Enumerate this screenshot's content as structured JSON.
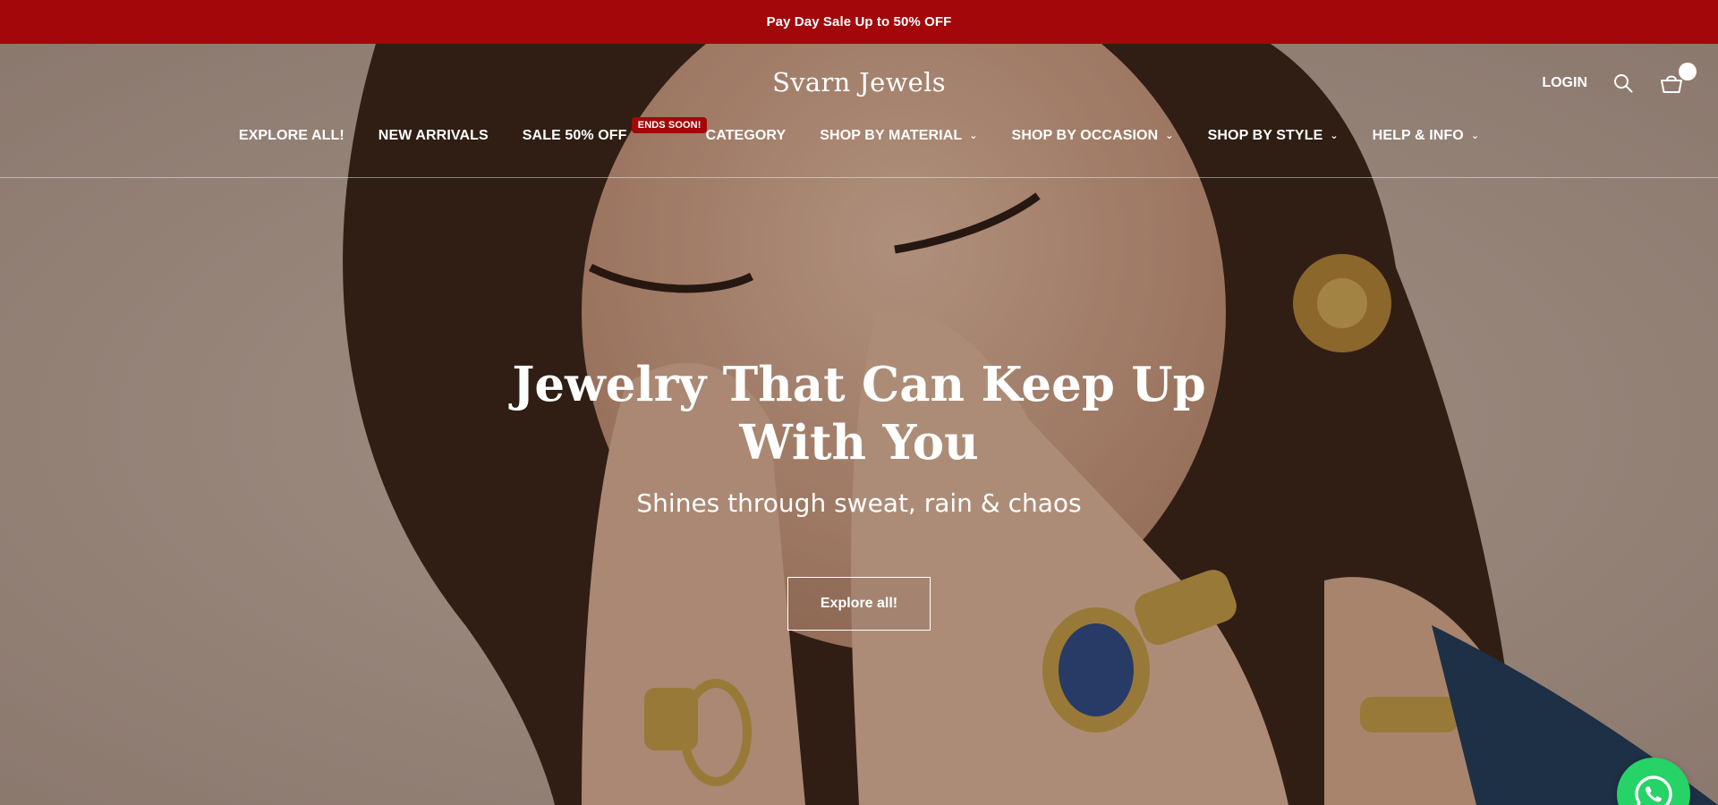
{
  "announcement": {
    "text": "Pay Day Sale Up to 50% OFF"
  },
  "header": {
    "logo": "Svarn Jewels",
    "login_label": "LOGIN",
    "search_icon": "search-icon",
    "cart_icon": "shopping-basket-icon"
  },
  "nav": {
    "items": [
      {
        "label": "EXPLORE ALL!"
      },
      {
        "label": "NEW ARRIVALS"
      },
      {
        "label": "SALE 50% OFF",
        "badge": "ENDS SOON!"
      },
      {
        "label": "CATEGORY"
      },
      {
        "label": "SHOP BY MATERIAL",
        "dropdown": "chevron-down-icon"
      },
      {
        "label": "SHOP BY OCCASION",
        "dropdown": "chevron-down-icon"
      },
      {
        "label": "SHOP BY STYLE",
        "dropdown": "chevron-down-icon"
      },
      {
        "label": "HELP & INFO",
        "dropdown": "chevron-down-icon"
      }
    ]
  },
  "hero": {
    "title": "Jewelry That Can Keep Up With You",
    "subtitle": "Shines through sweat, rain & chaos",
    "cta_label": "Explore all!"
  },
  "widgets": {
    "chat_icon": "whatsapp-icon"
  },
  "colors": {
    "announcement_bg": "#a3070a",
    "badge_bg": "#a3070a",
    "whatsapp_bg": "#25d366"
  }
}
